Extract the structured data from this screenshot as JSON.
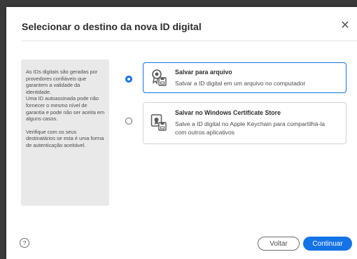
{
  "dialog": {
    "title": "Selecionar o destino da nova ID digital",
    "close_icon": "close-icon"
  },
  "info_panel": {
    "paragraphs": [
      "As IDs digitais são geradas por provedores confiáveis que garantem a validade da identidade.",
      "Uma ID autoassinada pode não fornecer o mesmo nível de garantia e pode não ser aceita em alguns casos.",
      "Verifique com os seus destinatários se esta é uma forma de autenticação aceitável."
    ]
  },
  "options": [
    {
      "title": "Salvar para arquivo",
      "description": "Salvar a ID digital em um arquivo no computador",
      "selected": true,
      "icon": "certificate-file-icon"
    },
    {
      "title": "Salvar no Windows Certificate Store",
      "description": "Salve a ID digital no Apple Keychain para compartilhá-la com outros aplicativos",
      "selected": false,
      "icon": "certificate-store-icon"
    }
  ],
  "footer": {
    "help_label": "?",
    "back_label": "Voltar",
    "continue_label": "Continuar"
  },
  "colors": {
    "accent": "#1473e6",
    "panel_bg": "#e9e9e9"
  }
}
